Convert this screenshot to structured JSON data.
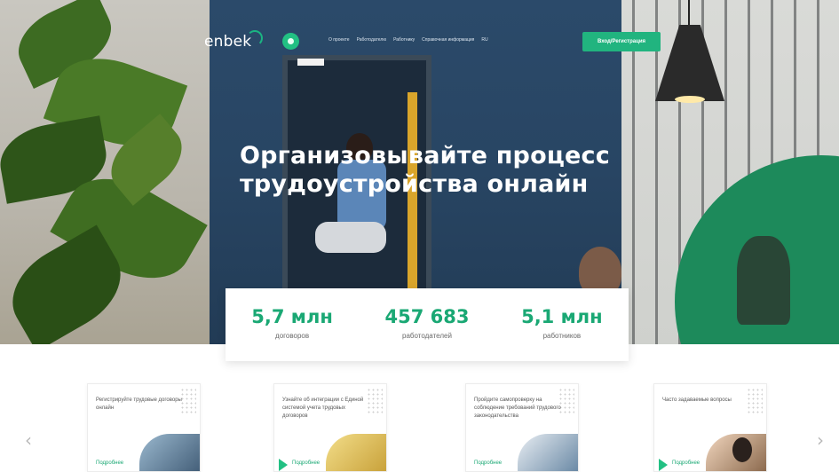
{
  "nav": {
    "logo": "enbek",
    "links": [
      "О проекте",
      "Работодателю",
      "Работнику",
      "Справочная информация",
      "RU"
    ],
    "login_button": "Вход/Регистрация"
  },
  "hero": {
    "headline_line1": "Организовывайте процесс",
    "headline_line2": "трудоустройства онлайн"
  },
  "stats": [
    {
      "value": "5,7 млн",
      "label": "договоров"
    },
    {
      "value": "457 683",
      "label": "работодателей"
    },
    {
      "value": "5,1 млн",
      "label": "работников"
    }
  ],
  "carousel": {
    "prev": "‹",
    "next": "›",
    "cards": [
      {
        "text": "Регистрируйте трудовые договоры онлайн",
        "link": "Подробнее"
      },
      {
        "text": "Узнайте об интеграции с Единой системой учета трудовых договоров",
        "link": "Подробнее"
      },
      {
        "text": "Пройдите самопроверку на соблюдение требований трудового законодательства",
        "link": "Подробнее"
      },
      {
        "text": "Часто задаваемые вопросы",
        "link": "Подробнее"
      }
    ]
  },
  "colors": {
    "accent": "#21b47f",
    "stat_value": "#1aa874",
    "hero_dark": "#2b4a6a"
  }
}
